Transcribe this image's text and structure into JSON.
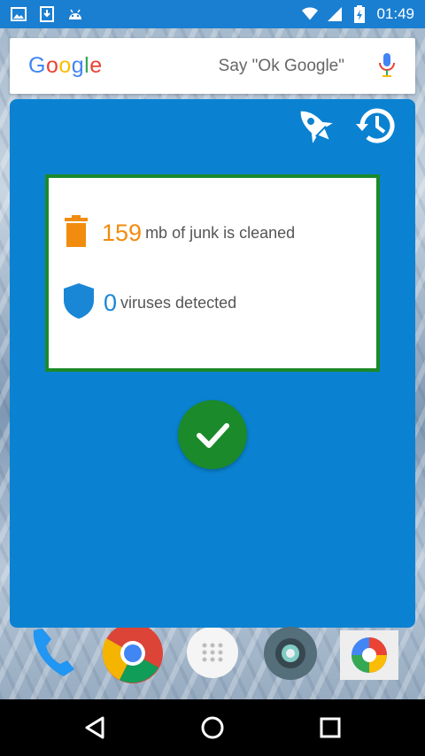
{
  "status_bar": {
    "time": "01:49",
    "icons": [
      "image-icon",
      "download-icon",
      "android-icon",
      "wifi-icon",
      "signal-icon",
      "battery-charging-icon"
    ]
  },
  "search": {
    "logo_text": "Google",
    "hint": "Say \"Ok Google\"",
    "logo_colors": [
      "#4285f4",
      "#ea4335",
      "#fbbc05",
      "#4285f4",
      "#34a853",
      "#ea4335"
    ]
  },
  "panel": {
    "background": "#0a82d1",
    "actions": [
      "rocket-icon",
      "history-icon"
    ]
  },
  "results": {
    "junk_amount": "159",
    "junk_text": "mb of junk is cleaned",
    "junk_color": "#f28c0f",
    "virus_count": "0",
    "virus_text": "viruses detected",
    "virus_color": "#1a86d6",
    "border_color": "#1b8a2a"
  },
  "dock": {
    "apps": [
      "phone-icon",
      "chrome-icon",
      "app-drawer-icon",
      "settings-icon",
      "photos-icon"
    ]
  },
  "nav": {
    "buttons": [
      "back-icon",
      "home-icon",
      "recents-icon"
    ]
  }
}
